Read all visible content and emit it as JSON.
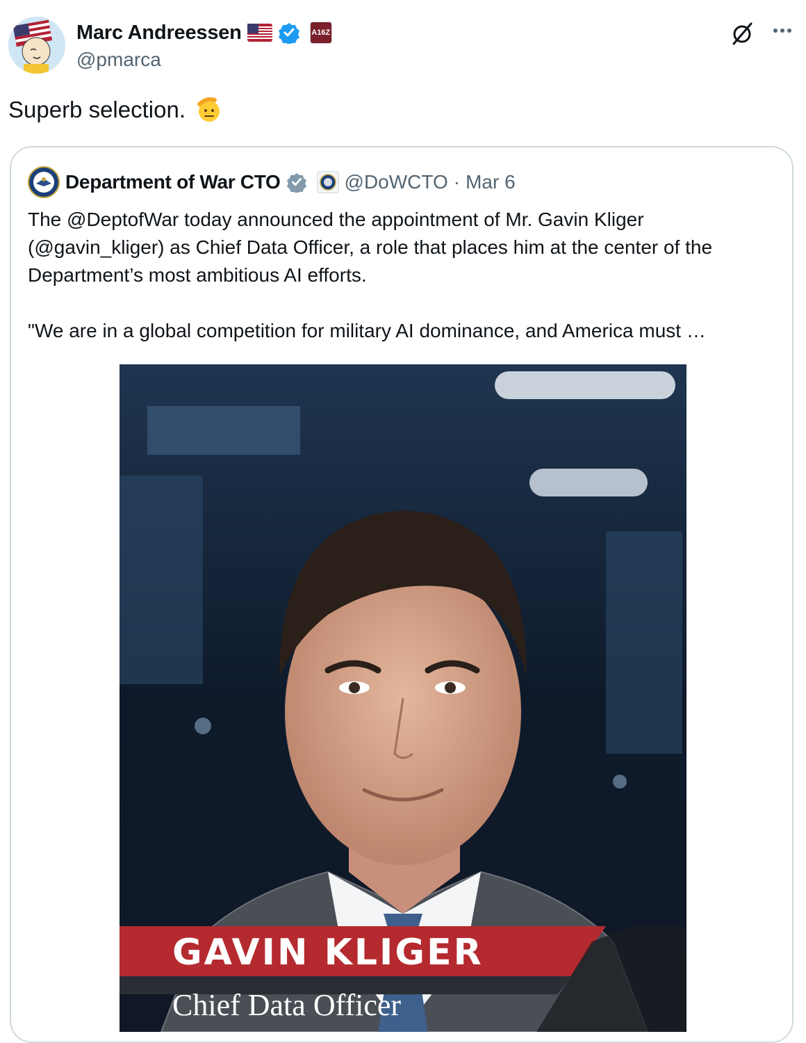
{
  "author": {
    "name": "Marc Andreessen",
    "handle": "@pmarca",
    "affiliate_badge": "A16Z",
    "icons": {
      "flag": "us-flag-icon",
      "verified": "verified-badge-icon",
      "grok": "grok-icon",
      "more": "more-icon"
    }
  },
  "tweet": {
    "text": "Superb selection.",
    "emoji": "saluting-face-emoji"
  },
  "quote": {
    "name": "Department of War CTO",
    "handle": "@DoWCTO",
    "separator": "·",
    "date": "Mar 6",
    "paragraph1": "The @DeptofWar today announced the appointment of Mr. Gavin Kliger (@gavin_kliger) as Chief Data Officer, a role that places him at the center of the Department’s most ambitious AI efforts.",
    "paragraph2": "\"We are in a global competition for military AI dominance, and America must …",
    "image": {
      "banner_name": "GAVIN KLIGER",
      "banner_title": "Chief Data Officer"
    }
  },
  "colors": {
    "text": "#0f1419",
    "secondary": "#536471",
    "border": "#cfd9de",
    "verified_blue": "#1d9bf0",
    "gov_gray": "#829aab",
    "banner_red": "#b52a2f"
  }
}
